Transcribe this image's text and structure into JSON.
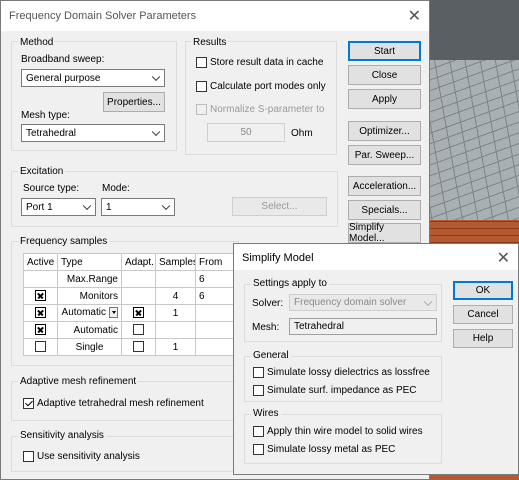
{
  "main": {
    "title": "Frequency Domain Solver Parameters",
    "method": {
      "group_label": "Method",
      "broadband_label": "Broadband sweep:",
      "broadband_value": "General purpose",
      "properties_label": "Properties...",
      "mesh_type_label": "Mesh type:",
      "mesh_type_value": "Tetrahedral"
    },
    "results": {
      "group_label": "Results",
      "store_cache_label": "Store result data in cache",
      "store_cache_checked": false,
      "calc_port_label": "Calculate port modes only",
      "calc_port_checked": false,
      "normalize_label": "Normalize S-parameter to",
      "normalize_checked": false,
      "normalize_value": "50",
      "normalize_unit": "Ohm"
    },
    "buttons": {
      "start": "Start",
      "close": "Close",
      "apply": "Apply",
      "optimizer": "Optimizer...",
      "par_sweep": "Par. Sweep...",
      "acceleration": "Acceleration...",
      "specials": "Specials...",
      "simplify_model": "Simplify Model..."
    },
    "excitation": {
      "group_label": "Excitation",
      "source_type_label": "Source type:",
      "source_type_value": "Port 1",
      "mode_label": "Mode:",
      "mode_value": "1",
      "select_label": "Select..."
    },
    "frequency_samples": {
      "group_label": "Frequency samples",
      "headers": [
        "Active",
        "Type",
        "Adapt.",
        "Samples",
        "From"
      ],
      "rows": [
        {
          "active": "",
          "type": "Max.Range",
          "adapt": "",
          "samples": "",
          "from": "6"
        },
        {
          "active": "x",
          "type": "Monitors",
          "adapt": "",
          "samples": "4",
          "from": "6"
        },
        {
          "active": "x",
          "type": "Automatic",
          "adapt": "x",
          "samples": "1",
          "from": ""
        },
        {
          "active": "x",
          "type": "Automatic",
          "adapt": "empty",
          "samples": "",
          "from": ""
        },
        {
          "active": "empty",
          "type": "Single",
          "adapt": "empty",
          "samples": "1",
          "from": ""
        }
      ]
    },
    "adaptive": {
      "group_label": "Adaptive mesh refinement",
      "tet_label": "Adaptive tetrahedral mesh refinement",
      "tet_checked": true
    },
    "sensitivity": {
      "group_label": "Sensitivity analysis",
      "use_label": "Use sensitivity analysis",
      "use_checked": false
    }
  },
  "simplify": {
    "title": "Simplify Model",
    "settings": {
      "group_label": "Settings apply to",
      "solver_label": "Solver:",
      "solver_value": "Frequency domain solver",
      "mesh_label": "Mesh:",
      "mesh_value": "Tetrahedral"
    },
    "general": {
      "group_label": "General",
      "lossy_diel_label": "Simulate lossy dielectrics as lossfree",
      "surf_imp_label": "Simulate surf. impedance as PEC"
    },
    "wires": {
      "group_label": "Wires",
      "thin_wire_label": "Apply thin wire model to solid wires",
      "lossy_metal_label": "Simulate lossy metal as PEC"
    },
    "buttons": {
      "ok": "OK",
      "cancel": "Cancel",
      "help": "Help"
    }
  }
}
